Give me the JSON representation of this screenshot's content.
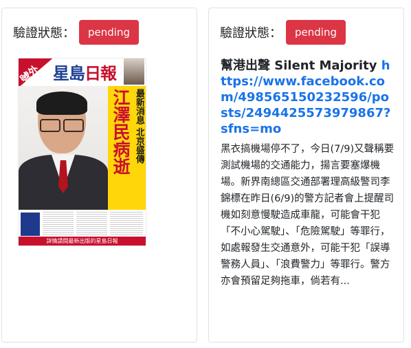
{
  "cards": [
    {
      "status_label": "驗證狀態：",
      "status_badge": "pending",
      "image": {
        "corner_badge": "號外",
        "masthead_blue": "星島",
        "masthead_red": "日報",
        "headline_main": "江澤民病逝",
        "headline_side": "最新消息 北京盛傳",
        "footer": "詳情請閱最新出版的星島日報"
      }
    },
    {
      "status_label": "驗證狀態：",
      "status_badge": "pending",
      "title_text": "幫港出聲 Silent Majority ",
      "title_link": "https://www.facebook.com/498565150232596/posts/2494425573979867?sfns=mo",
      "body": "黑衣搞機場停不了，今日(7/9)又聲稱要測試機場的交通能力，揚言要塞爆機場。新界南總區交通部署理高級警司李錦標在昨日(6/9)的警方記者會上提醒司機如刻意慢駛造成車龍，可能會干犯「不小心駕駛」、「危險駕駛」等罪行，如處報發生交通意外，可能干犯「誤導警務人員」、「浪費警力」等罪行。警方亦會預留足夠拖車，倘若有..."
    }
  ],
  "colors": {
    "badge_bg": "#dc3545",
    "link": "#1a73e8",
    "masthead_blue": "#1e3f94",
    "masthead_red": "#c8102e",
    "headline_panel": "#ffd60a"
  }
}
